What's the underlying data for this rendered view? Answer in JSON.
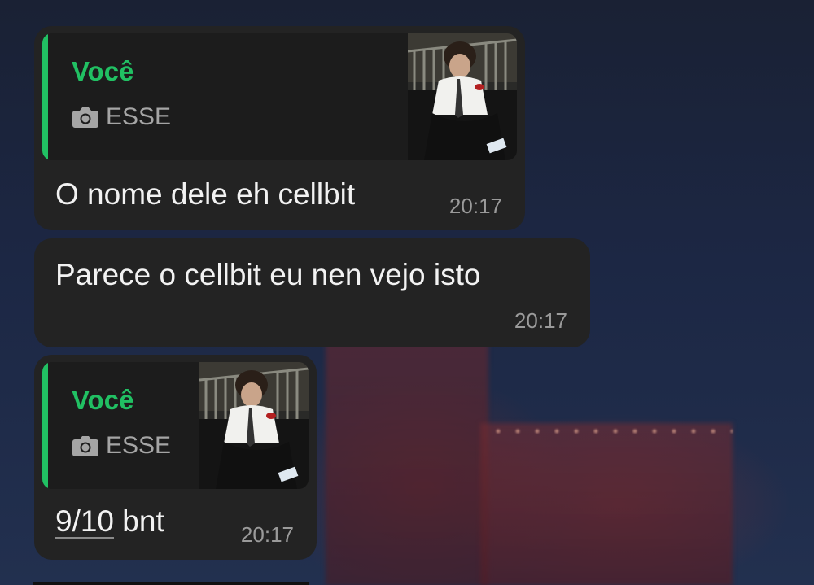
{
  "colors": {
    "bubble": "#232323",
    "reply_background": "#1c1c1c",
    "accent_green": "#21c063",
    "timestamp": "#9a9a9a"
  },
  "messages": [
    {
      "reply": {
        "author": "Você",
        "caption": "ESSE",
        "caption_icon": "camera-icon",
        "thumbnail": "photo-thumbnail"
      },
      "text": "O nome dele eh cellbit",
      "time": "20:17"
    },
    {
      "text": "Parece o cellbit eu nen vejo isto",
      "time": "20:17"
    },
    {
      "reply": {
        "author": "Você",
        "caption": "ESSE",
        "caption_icon": "camera-icon",
        "thumbnail": "photo-thumbnail"
      },
      "text_parts": {
        "link": "9/10",
        "rest": " bnt"
      },
      "time": "20:17"
    }
  ]
}
